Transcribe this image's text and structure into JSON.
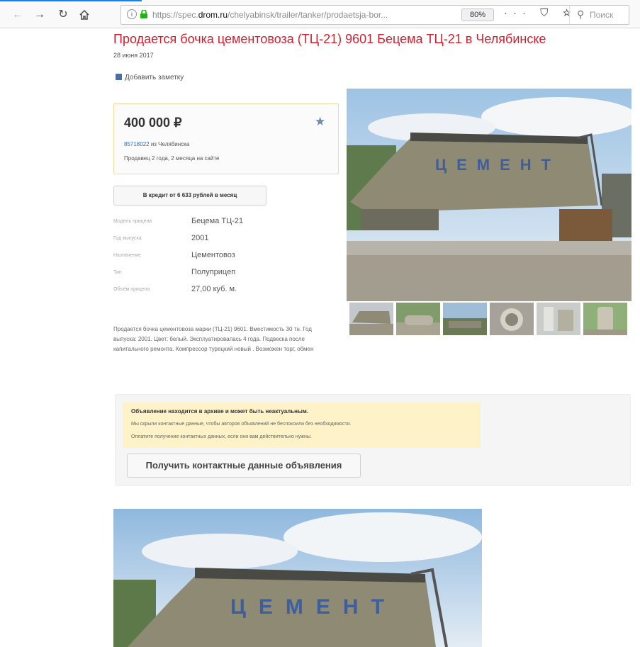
{
  "browser": {
    "back_icon": "arrow-left-icon",
    "forward_icon": "arrow-right-icon",
    "reload_icon": "reload-icon",
    "home_icon": "home-icon",
    "url_prefix": "https://spec.",
    "url_host": "drom.ru",
    "url_path": "/chelyabinsk/trailer/tanker/prodaetsja-bor...",
    "zoom": "80%",
    "page_actions": "··· ⛉ ☆",
    "search_placeholder": "Поиск"
  },
  "listing": {
    "title": "Продается бочка цементовоза (ТЦ-21) 9601 Бецема ТЦ-21 в Челябинске",
    "date": "28 июня 2017",
    "add_note": "Добавить заметку",
    "price": "400 000 ₽",
    "seller_id": "85718022",
    "seller_city": " из Челябинска",
    "seller_age": "Продавец 2 года, 2 месяца на сайте",
    "credit_button": "В кредит от 6 633 рублей в месяц",
    "specs": [
      {
        "label": "Модель прицепа",
        "value": "Бецема ТЦ-21"
      },
      {
        "label": "Год выпуска",
        "value": "2001"
      },
      {
        "label": "Назначение",
        "value": "Цементовоз"
      },
      {
        "label": "Тип",
        "value": "Полуприцеп"
      },
      {
        "label": "Объём прицепа",
        "value": "27,00 куб. м."
      }
    ],
    "description": "Продается бочка цементовоза марки (ТЦ-21) 9601. Вместимость 30 тн. Год выпуска: 2001. Цвет: белый. Эксплуатировалась 4 года. Подвеска после капитального ремонта. Компрессор турецкий новый . Возможен торг, обмен"
  },
  "archive": {
    "title": "Объявление находится в архиве и может быть неактуальным.",
    "line1": "Мы скрыли контактные данные, чтобы авторов объявлений не беспокоили без необходимости.",
    "line2": "Оплатите получение контактных данных, если они вам действительно нужны.",
    "contacts_button": "Получить контактные данные объявления"
  },
  "colors": {
    "title_red": "#d41e2f",
    "link_blue": "#3b6db3",
    "notice_yellow": "#fdf2c8"
  }
}
